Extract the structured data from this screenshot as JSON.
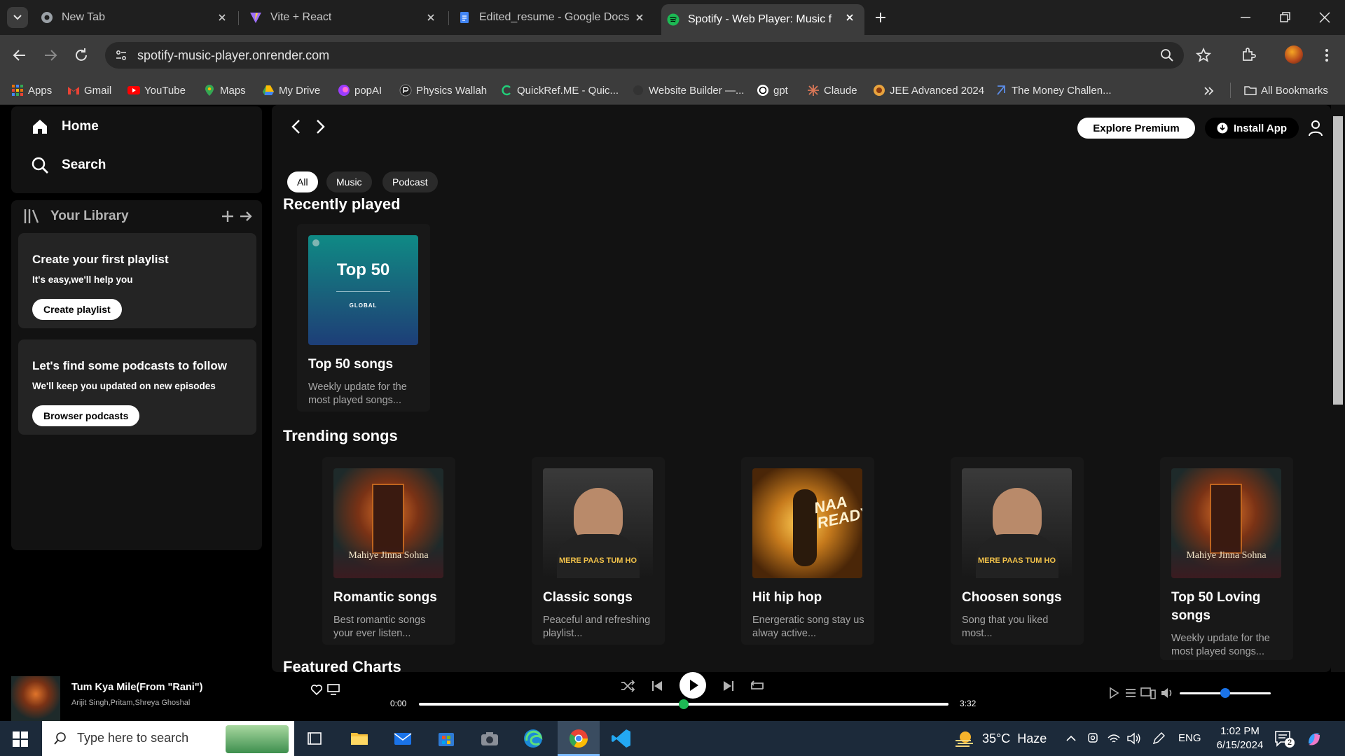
{
  "browser": {
    "tabs": [
      {
        "title": "New Tab"
      },
      {
        "title": "Vite + React"
      },
      {
        "title": "Edited_resume - Google Docs"
      },
      {
        "title": "Spotify - Web Player: Music for"
      }
    ],
    "url": "spotify-music-player.onrender.com",
    "bookmarks": [
      "Apps",
      "Gmail",
      "YouTube",
      "Maps",
      "My Drive",
      "popAI",
      "Physics Wallah",
      "QuickRef.ME - Quic...",
      "Website Builder —...",
      "gpt",
      "Claude",
      "JEE Advanced 2024",
      "The Money Challen..."
    ],
    "all_bookmarks": "All Bookmarks"
  },
  "sidebar": {
    "home": "Home",
    "search": "Search",
    "library": "Your Library",
    "playlist_box": {
      "title": "Create your first playlist",
      "subtitle": "It's easy,we'll help you",
      "button": "Create playlist"
    },
    "podcast_box": {
      "title": "Let's find some podcasts to follow",
      "subtitle": "We'll keep you updated on new episodes",
      "button": "Browser podcasts"
    }
  },
  "header": {
    "explore": "Explore Premium",
    "install": "Install App"
  },
  "filters": [
    "All",
    "Music",
    "Podcast"
  ],
  "sections": {
    "recent": "Recently played",
    "trending": "Trending songs",
    "featured": "Featured Charts"
  },
  "recent": [
    {
      "title": "Top 50 songs",
      "desc": "Weekly update for the most played songs...",
      "cover_title": "Top 50",
      "cover_sub": "GLOBAL"
    }
  ],
  "trending": [
    {
      "title": "Romantic songs",
      "desc": "Best romantic songs your ever listen...",
      "cover_text": "Mahiye Jinna Sohna"
    },
    {
      "title": "Classic songs",
      "desc": "Peaceful and refreshing playlist...",
      "cover_text": "MERE PAAS TUM HO"
    },
    {
      "title": "Hit hip hop",
      "desc": "Energeratic song stay us alway active...",
      "cover_text": "NAA READY"
    },
    {
      "title": "Choosen songs",
      "desc": "Song that you liked most...",
      "cover_text": "MERE PAAS TUM HO"
    },
    {
      "title": "Top 50 Loving songs",
      "desc": "Weekly update for the most played songs...",
      "cover_text": "Mahiye Jinna Sohna"
    }
  ],
  "player": {
    "track": "Tum Kya Mile(From \"Rani\")",
    "artists": "Arijit Singh,Pritam,Shreya Ghoshal",
    "current": "0:00",
    "total": "3:32",
    "progress": 0.5,
    "volume": 0.5
  },
  "taskbar": {
    "search_placeholder": "Type here to search",
    "weather": "35°C  Haze",
    "lang": "ENG",
    "time": "1:02 PM",
    "date": "6/15/2024",
    "notif": "2"
  },
  "colors": {
    "accent": "#1db954",
    "bg": "#121212"
  }
}
